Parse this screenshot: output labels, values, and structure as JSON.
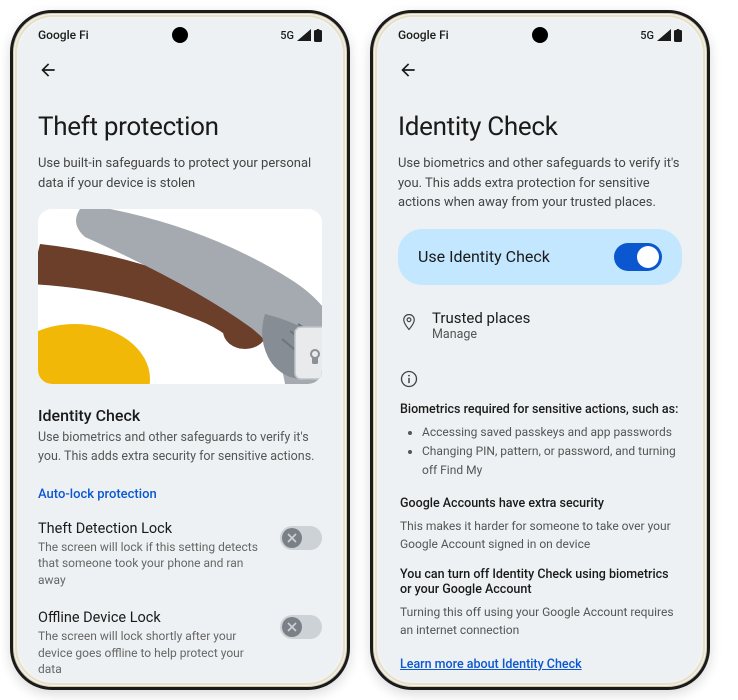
{
  "statusBar": {
    "carrier": "Google Fi",
    "network": "5G"
  },
  "left": {
    "title": "Theft protection",
    "subtitle": "Use built-in safeguards to protect your personal data if your device is stolen",
    "identityCheck": {
      "title": "Identity Check",
      "text": "Use biometrics and other safeguards to verify it's you. This adds extra security for sensitive actions."
    },
    "autoLockLabel": "Auto-lock protection",
    "rows": [
      {
        "title": "Theft Detection Lock",
        "desc": "The screen will lock if this setting detects that someone took your phone and ran away"
      },
      {
        "title": "Offline Device Lock",
        "desc": "The screen will lock shortly after your device goes offline to help protect your data"
      }
    ]
  },
  "right": {
    "title": "Identity Check",
    "subtitle": "Use biometrics and other safeguards to verify it's you. This adds extra protection for sensitive actions when away from your trusted places.",
    "toggleLabel": "Use Identity Check",
    "trusted": {
      "title": "Trusted places",
      "sub": "Manage"
    },
    "biometricsHeading": "Biometrics required for sensitive actions, such as:",
    "bullets": [
      "Accessing saved passkeys and app passwords",
      "Changing PIN, pattern, or password, and turning off Find My"
    ],
    "block1": {
      "heading": "Google Accounts have extra security",
      "body": "This makes it harder for someone to take over your Google Account signed in on device"
    },
    "block2": {
      "heading": "You can turn off Identity Check using biometrics or your Google Account",
      "body": "Turning this off using your Google Account requires an internet connection"
    },
    "learnMore": "Learn more about Identity Check"
  }
}
